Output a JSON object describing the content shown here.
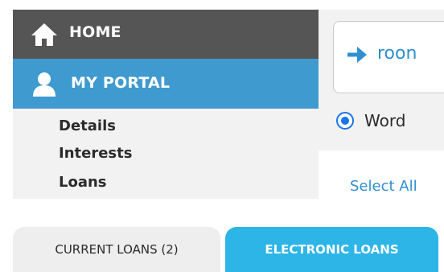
{
  "nav": {
    "home": {
      "label": "HOME",
      "icon": "home-icon",
      "bg": "#555555"
    },
    "portal": {
      "label": "MY PORTAL",
      "icon": "user-icon",
      "bg": "#3f9ad0"
    },
    "subitems": [
      {
        "label": "Details"
      },
      {
        "label": "Interests"
      },
      {
        "label": "Loans"
      }
    ]
  },
  "search": {
    "icon": "arrow-right-icon",
    "value": "roon"
  },
  "radio": {
    "label": "Word",
    "checked": true
  },
  "select_all": {
    "label": "Select All"
  },
  "tabs": [
    {
      "label": "CURRENT LOANS (2)",
      "active": false
    },
    {
      "label": "ELECTRONIC LOANS",
      "active": true
    }
  ],
  "colors": {
    "accent": "#2db5e8",
    "link": "#2f8fcf",
    "radio": "#1a73e8"
  }
}
